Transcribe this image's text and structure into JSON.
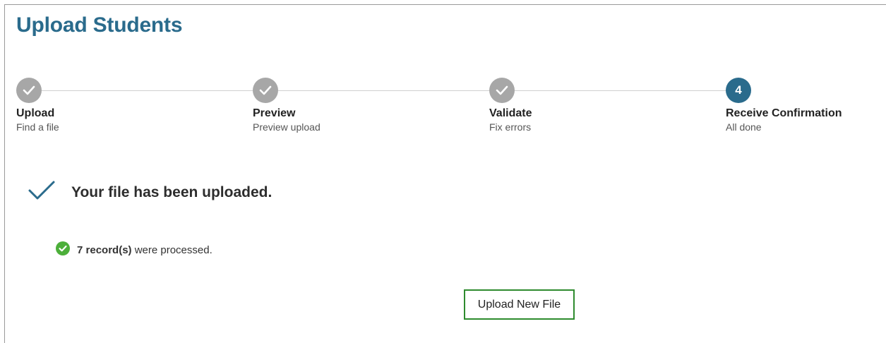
{
  "page": {
    "title": "Upload Students"
  },
  "steps": [
    {
      "label": "Upload",
      "description": "Find a file",
      "state": "done"
    },
    {
      "label": "Preview",
      "description": "Preview upload",
      "state": "done"
    },
    {
      "label": "Validate",
      "description": "Fix errors",
      "state": "done"
    },
    {
      "label": "Receive Confirmation",
      "description": "All done",
      "state": "current",
      "number": "4"
    }
  ],
  "result": {
    "message": "Your file has been uploaded.",
    "records_count": "7 record(s)",
    "records_suffix": " were processed."
  },
  "actions": {
    "upload_new_label": "Upload New File"
  },
  "colors": {
    "title": "#2a6b8c",
    "step_done": "#a7a7a7",
    "step_current": "#2a6b8c",
    "success_green": "#4caf3a",
    "button_border": "#2e8b2e"
  }
}
